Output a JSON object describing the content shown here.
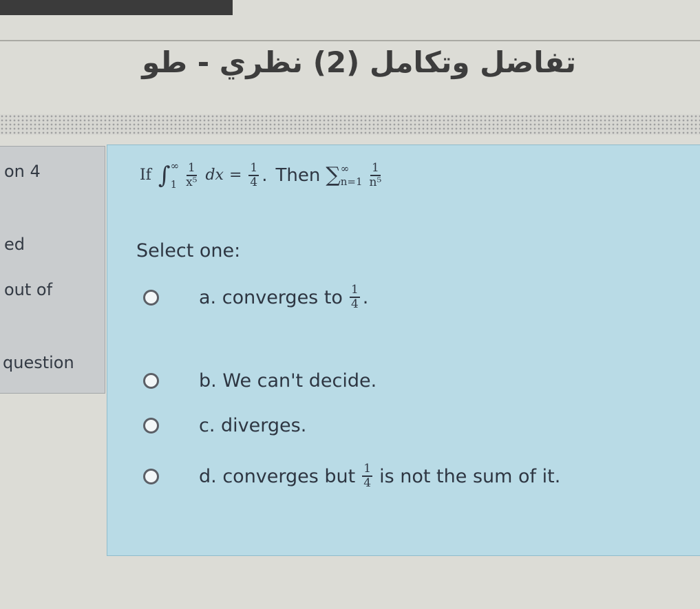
{
  "header": {
    "course_title": "تفاضل وتكامل (2) نظري - طو"
  },
  "info": {
    "question_label": "on 4",
    "status": "ed",
    "marks": "out of",
    "flag": "question"
  },
  "question": {
    "if_word": "If",
    "integral_upper": "∞",
    "integral_lower": "1",
    "integrand_num": "1",
    "integrand_den": "x⁵",
    "dx": "dx",
    "equals": "=",
    "value_num": "1",
    "value_den": "4",
    "after_value": ".",
    "then_word": "Then",
    "sum_upper": "∞",
    "sum_lower": "n=1",
    "term_num": "1",
    "term_den": "n⁵"
  },
  "prompt": "Select one:",
  "options": [
    {
      "letter": "a.",
      "text": "converges to",
      "frac_num": "1",
      "frac_den": "4",
      "suffix": "."
    },
    {
      "letter": "b.",
      "text": "We can't decide."
    },
    {
      "letter": "c.",
      "text": "diverges."
    },
    {
      "letter": "d.",
      "text": "converges but",
      "frac_num": "1",
      "frac_den": "4",
      "suffix": "is not the sum of it."
    }
  ]
}
